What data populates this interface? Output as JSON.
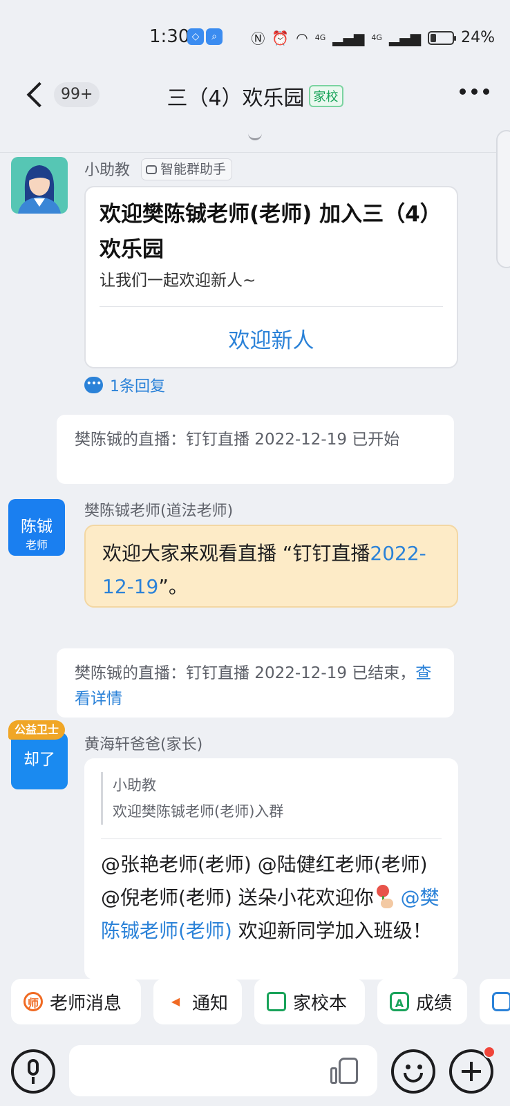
{
  "status_bar": {
    "time": "1:30",
    "signal_labels": [
      "4G",
      "4G"
    ],
    "battery": "24%"
  },
  "header": {
    "unread": "99+",
    "title": "三（4）欢乐园",
    "tag": "家校"
  },
  "messages": {
    "bot": {
      "sender": "小助教",
      "badge": "智能群助手",
      "card_title": "欢迎樊陈铖老师(老师) 加入三（4）欢乐园",
      "card_sub": "让我们一起欢迎新人~",
      "card_action": "欢迎新人",
      "reply_count": "1条回复"
    },
    "sys_live_start": "樊陈铖的直播：钉钉直播 2022-12-19 已开始",
    "teacher": {
      "avatar_name": "陈铖",
      "avatar_role": "老师",
      "sender": "樊陈铖老师(道法老师)",
      "text_before": "欢迎大家来观看直播 “钉钉直播",
      "text_link": "2022-12-19",
      "text_after": "”。"
    },
    "sys_live_end": {
      "text": "樊陈铖的直播：钉钉直播 2022-12-19 已结束，",
      "link": "查看详情"
    },
    "parent": {
      "badge": "公益卫士",
      "avatar_name": "却了",
      "sender": "黄海轩爸爸(家长)",
      "quote_name": "小助教",
      "quote_text": "欢迎樊陈铖老师(老师)入群",
      "text_part1": "@张艳老师(老师) @陆健红老师(老师) @倪老师(老师) 送朵小花欢迎你",
      "mention": "@樊陈铖老师(老师)",
      "text_part2": " 欢迎新同学加入班级！"
    }
  },
  "quick_actions": [
    {
      "label": "老师消息",
      "icon": "teacher-icon",
      "color": "#f06a23"
    },
    {
      "label": "通知",
      "icon": "megaphone-icon",
      "color": "#f06a23"
    },
    {
      "label": "家校本",
      "icon": "notebook-icon",
      "color": "#19a35a"
    },
    {
      "label": "成绩",
      "icon": "grade-icon",
      "color": "#19a35a"
    }
  ],
  "input": {
    "placeholder": ""
  }
}
